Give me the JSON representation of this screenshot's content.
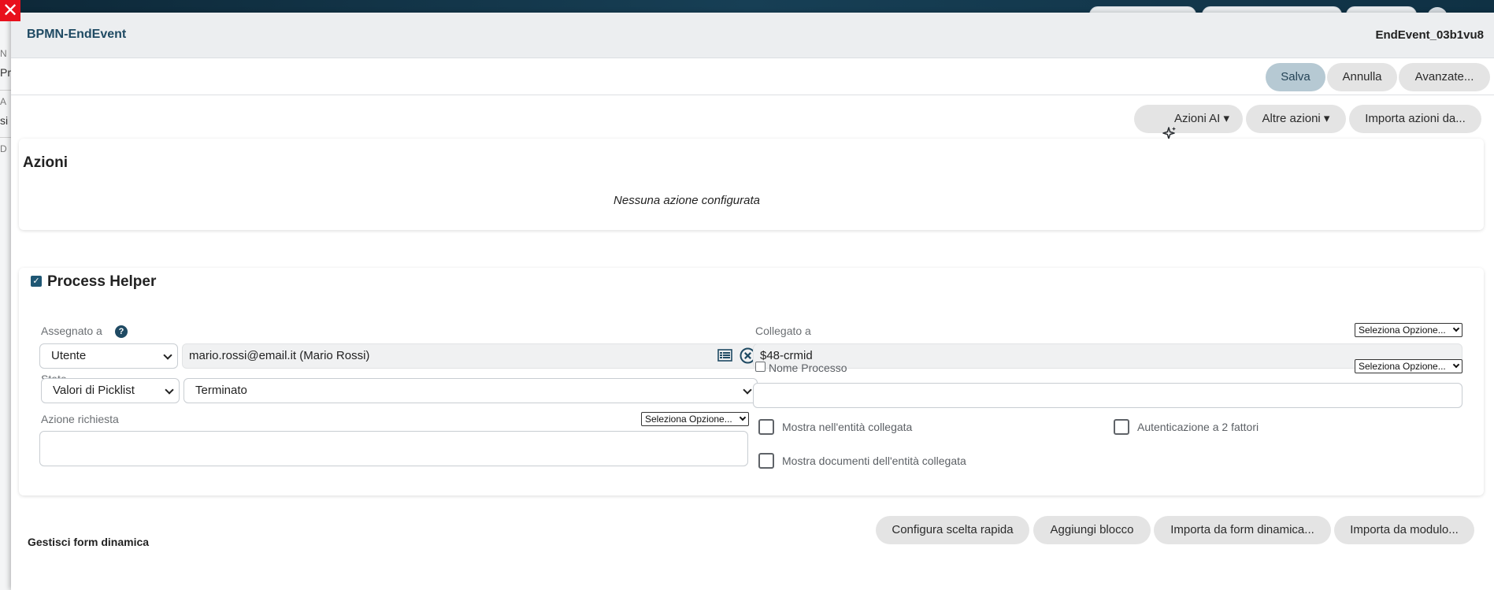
{
  "close_icon_glyph": "✕",
  "modal": {
    "title": "BPMN-EndEvent",
    "element_id": "EndEvent_03b1vu8"
  },
  "toolbar": {
    "save_label": "Salva",
    "cancel_label": "Annulla",
    "advanced_label": "Avanzate..."
  },
  "actions_bar": {
    "ai_actions_label": "Azioni AI ▾",
    "other_actions_label": "Altre azioni ▾",
    "import_actions_label": "Importa azioni da..."
  },
  "azioni": {
    "title": "Azioni",
    "empty_text": "Nessuna azione configurata"
  },
  "process_helper": {
    "checked_glyph": "✓",
    "title": "Process Helper",
    "assigned_label": "Assegnato a",
    "help_glyph": "?",
    "assigned_type": "Utente",
    "assigned_value": "mario.rossi@email.it (Mario Rossi)",
    "linked_label": "Collegato a",
    "linked_value": "$48-crmid",
    "option_select": "Seleziona Opzione...",
    "stato_label": "Stato",
    "stato_source": "Valori di Picklist",
    "stato_value": "Terminato",
    "process_name_label": "Nome Processo",
    "process_name_value": "",
    "required_action_label": "Azione richiesta",
    "required_action_value": "",
    "show_in_linked_label": "Mostra nell'entità collegata",
    "two_factor_label": "Autenticazione a 2 fattori",
    "show_docs_label": "Mostra documenti dell'entità collegata"
  },
  "dynamic_form": {
    "title": "Gestisci form dinamica",
    "quick_choice_label": "Configura scelta rapida",
    "add_block_label": "Aggiungi blocco",
    "import_form_label": "Importa da form dinamica...",
    "import_module_label": "Importa da modulo..."
  },
  "background_page": {
    "row1_small": "N",
    "row1": "Pr",
    "row2_small": "A",
    "row2": "si",
    "row3_small": "D"
  },
  "colors": {
    "accent": "#1f4a63",
    "close": "#e8101c",
    "primary_button": "#b6c9d3",
    "button": "#e4e4e4"
  },
  "icons": [
    "close-icon",
    "sparkle-icon",
    "help-icon",
    "list-icon",
    "clear-circle-icon",
    "chevron-down-icon"
  ]
}
